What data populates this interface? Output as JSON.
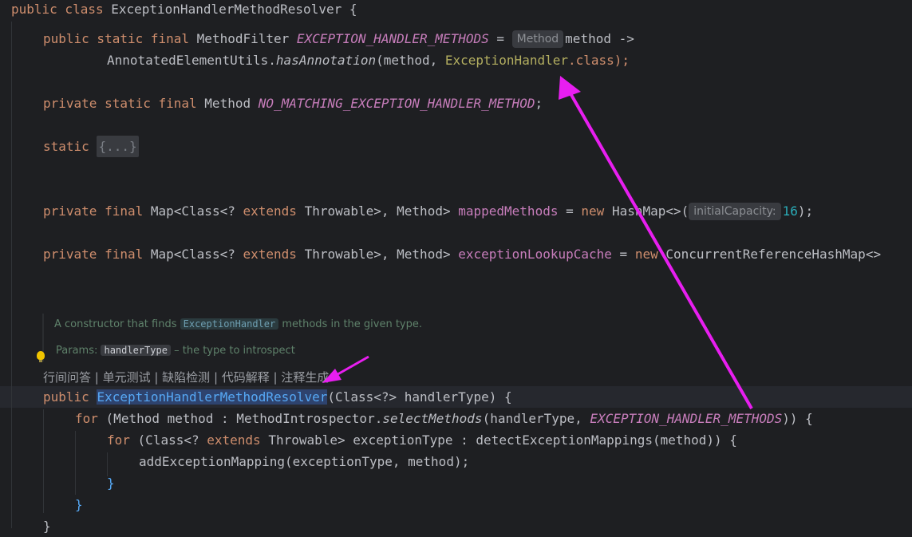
{
  "editor": {
    "class_decl": {
      "kw": "public class",
      "name": "ExceptionHandlerMethodResolver",
      "brace": "{"
    },
    "line_filter": {
      "mods": "public static final",
      "type": "MethodFilter",
      "field": "EXCEPTION_HANDLER_METHODS",
      "eq": "=",
      "hint": "Method",
      "rest": "method ->"
    },
    "line_filter2": {
      "cls": "AnnotatedElementUtils.",
      "method": "hasAnnotation",
      "args_open": "(method, ",
      "ann": "ExceptionHandler",
      "tail": ".class);"
    },
    "line_nomatch": {
      "mods": "private static final",
      "type": "Method",
      "field": "NO_MATCHING_EXCEPTION_HANDLER_METHOD",
      "semi": ";"
    },
    "line_static": {
      "kw": "static",
      "fold": "{...}"
    },
    "line_mapped": {
      "mods": "private final",
      "type_a": "Map<Class<?",
      "ext": "extends",
      "type_b": "Throwable>, Method>",
      "name": "mappedMethods",
      "eq": "=",
      "new": "new",
      "ctor": "HashMap<>(",
      "hint": "initialCapacity:",
      "num": "16",
      "end": ");"
    },
    "line_cache": {
      "mods": "private final",
      "type_a": "Map<Class<?",
      "ext": "extends",
      "type_b": "Throwable>, Method>",
      "name": "exceptionLookupCache",
      "eq": "=",
      "new": "new",
      "ctor": "ConcurrentReferenceHashMap<>"
    },
    "doc": {
      "line1_pre": "A constructor that finds ",
      "line1_code": "ExceptionHandler",
      "line1_post": " methods in the given type.",
      "params_label": "Params: ",
      "params_code": "handlerType",
      "params_post": " – the type to introspect"
    },
    "codelens": "行间问答 | 单元测试 | 缺陷检测 | 代码解释 | 注释生成",
    "line_ctor": {
      "kw": "public",
      "name": "ExceptionHandlerMethodResolver",
      "params": "(Class<?> handlerType) {"
    },
    "line_for1": {
      "kw": "for",
      "a": "(Method method : MethodIntrospector.",
      "method": "selectMethods",
      "b": "(handlerType, ",
      "field": "EXCEPTION_HANDLER_METHODS",
      "c": ")) {"
    },
    "line_for2": {
      "kw": "for",
      "a": "(Class<?",
      "ext": "extends",
      "b": "Throwable> exceptionType : detectExceptionMappings(method)) {"
    },
    "line_add": "addExceptionMapping(exceptionType, method);",
    "close1": "}",
    "close2": "}",
    "close3": "}"
  },
  "colors": {
    "background": "#1e1f22",
    "keyword": "#cf8e6d",
    "field": "#c77dbb",
    "annotation": "#b3ae60",
    "number": "#2aacb8",
    "arrow": "#e81ef0"
  }
}
